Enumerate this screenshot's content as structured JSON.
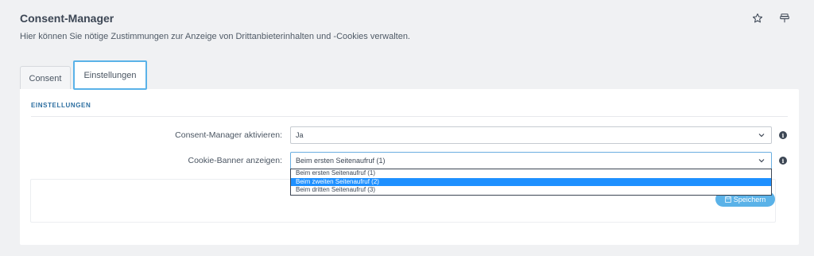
{
  "header": {
    "title": "Consent-Manager",
    "subtitle": "Hier können Sie nötige Zustimmungen zur Anzeige von Drittanbieterinhalten und -Cookies verwalten."
  },
  "icons": {
    "star": "star-icon",
    "pin": "pin-icon",
    "info": "info-icon",
    "chevron": "chevron-down-icon",
    "save": "save-icon"
  },
  "tabs": [
    {
      "label": "Consent"
    },
    {
      "label": "Einstellungen"
    }
  ],
  "section": {
    "title": "EINSTELLUNGEN"
  },
  "form": {
    "consent_manager": {
      "label": "Consent-Manager aktivieren:",
      "value": "Ja"
    },
    "cookie_banner": {
      "label": "Cookie-Banner anzeigen:",
      "value": "Beim ersten Seitenaufruf (1)",
      "options": [
        "Beim ersten Seitenaufruf (1)",
        "Beim zweiten Seitenaufruf (2)",
        "Beim dritten Seitenaufruf (3)"
      ],
      "highlighted_option": "Beim zweiten Seitenaufruf (2)"
    }
  },
  "toolbar": {
    "save_label": "Speichern"
  },
  "colors": {
    "accent": "#5ab2e8",
    "highlight": "#1e90ff",
    "heading": "#2c6ea0"
  }
}
